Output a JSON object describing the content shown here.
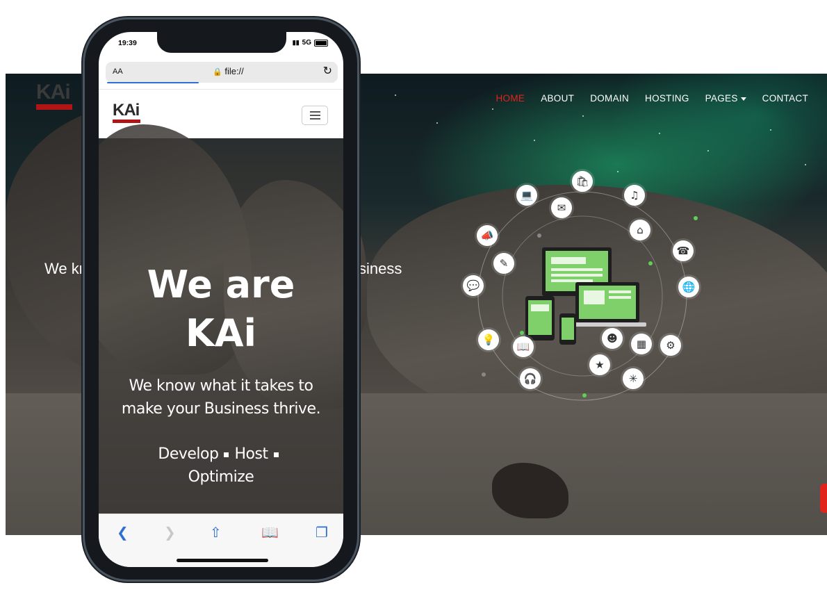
{
  "desktop": {
    "logo_text": "KAi",
    "nav": [
      {
        "label": "HOME",
        "active": true
      },
      {
        "label": "ABOUT",
        "active": false
      },
      {
        "label": "DOMAIN",
        "active": false
      },
      {
        "label": "HOSTING",
        "active": false
      },
      {
        "label": "PAGES",
        "active": false,
        "dropdown": true
      },
      {
        "label": "CONTACT",
        "active": false
      }
    ],
    "hero_left_text": "We kr",
    "hero_right_text": "siness",
    "accent_color": "#e0231b"
  },
  "phone": {
    "status_time": "19:39",
    "status_network": "5G",
    "browser": {
      "text_size_label": "AA",
      "url": "file://",
      "reload_icon": "reload-icon"
    },
    "logo_text": "KAi",
    "hero": {
      "title_line1": "We are",
      "title_line2": "KAi",
      "subtitle": "We know what it takes to make your Business thrive.",
      "tag1": "Develop",
      "tag2": "Host",
      "tag3": "Optimize"
    },
    "toolbar_icons": [
      "back-icon",
      "forward-icon",
      "share-icon",
      "bookmarks-icon",
      "tabs-icon"
    ]
  }
}
